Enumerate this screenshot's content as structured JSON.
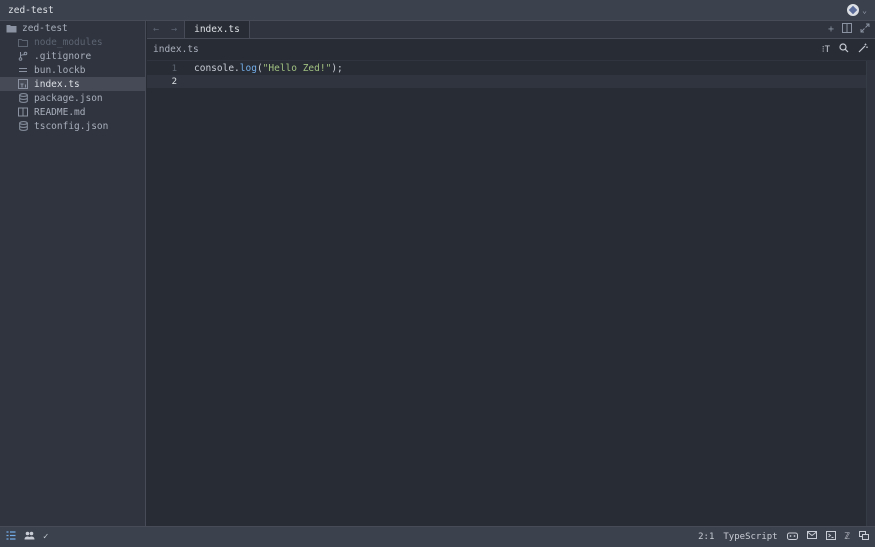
{
  "window": {
    "project_title": "zed-test"
  },
  "sidebar": {
    "root": {
      "label": "zed-test",
      "icon": "folder-open-icon"
    },
    "items": [
      {
        "label": "node_modules",
        "icon": "folder-icon",
        "dimmed": true
      },
      {
        "label": ".gitignore",
        "icon": "git-branch-icon"
      },
      {
        "label": "bun.lockb",
        "icon": "lines-icon"
      },
      {
        "label": "index.ts",
        "icon": "typescript-file-icon",
        "selected": true
      },
      {
        "label": "package.json",
        "icon": "database-icon"
      },
      {
        "label": "README.md",
        "icon": "book-icon"
      },
      {
        "label": "tsconfig.json",
        "icon": "database-icon"
      }
    ]
  },
  "tabs": [
    {
      "label": "index.ts",
      "active": true
    }
  ],
  "breadcrumb": {
    "file": "index.ts"
  },
  "editor": {
    "lines": [
      {
        "number": "1",
        "tokens": [
          {
            "text": "console.",
            "kind": "plain"
          },
          {
            "text": "log",
            "kind": "fn"
          },
          {
            "text": "(",
            "kind": "plain"
          },
          {
            "text": "\"Hello Zed!\"",
            "kind": "str"
          },
          {
            "text": ");",
            "kind": "plain"
          }
        ]
      },
      {
        "number": "2",
        "tokens": [],
        "active": true
      }
    ]
  },
  "status": {
    "cursor_position": "2:1",
    "language": "TypeScript"
  },
  "colors": {
    "background": "#282c34",
    "panel": "#2f343e",
    "titlebar": "#3b414d",
    "border": "#464b57",
    "string": "#a1c181",
    "function": "#73ade9",
    "accent": "#73ade9"
  }
}
